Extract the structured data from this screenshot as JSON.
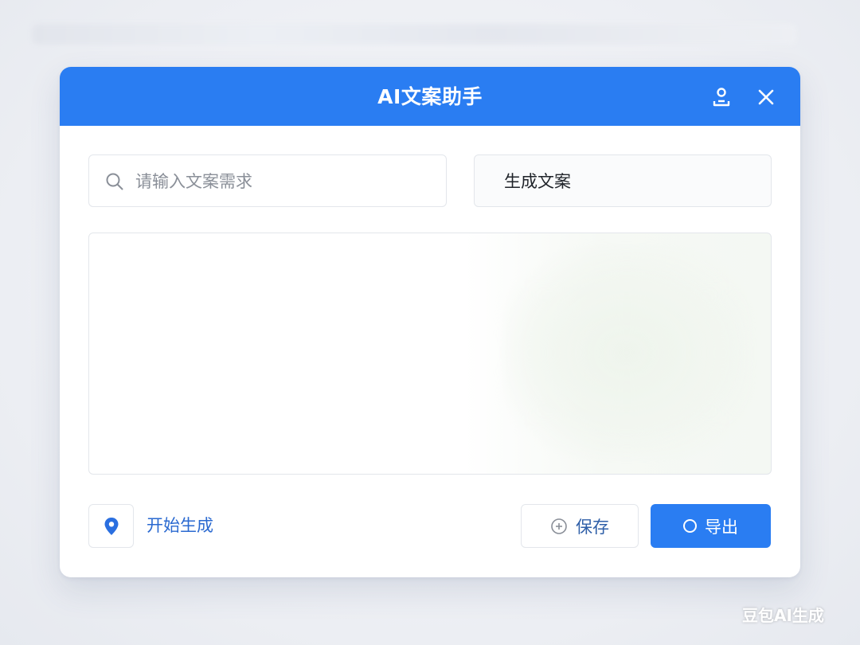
{
  "dialog": {
    "title": "AI文案助手",
    "header_icons": [
      "user-icon",
      "close-icon"
    ]
  },
  "search": {
    "placeholder": "请输入文案需求",
    "value": "",
    "icon": "search-icon"
  },
  "generate": {
    "label": "生成文案"
  },
  "output": {
    "text": ""
  },
  "footer": {
    "location_icon": "location-pin-icon",
    "start_label": "开始生成",
    "save_label": "保存",
    "save_icon": "plus-circle-icon",
    "export_label": "导出",
    "export_icon": "ring-icon"
  },
  "watermark": "豆包AI生成",
  "colors": {
    "accent": "#2a7df2",
    "link": "#2a69d0",
    "border": "#e3e6eb"
  }
}
